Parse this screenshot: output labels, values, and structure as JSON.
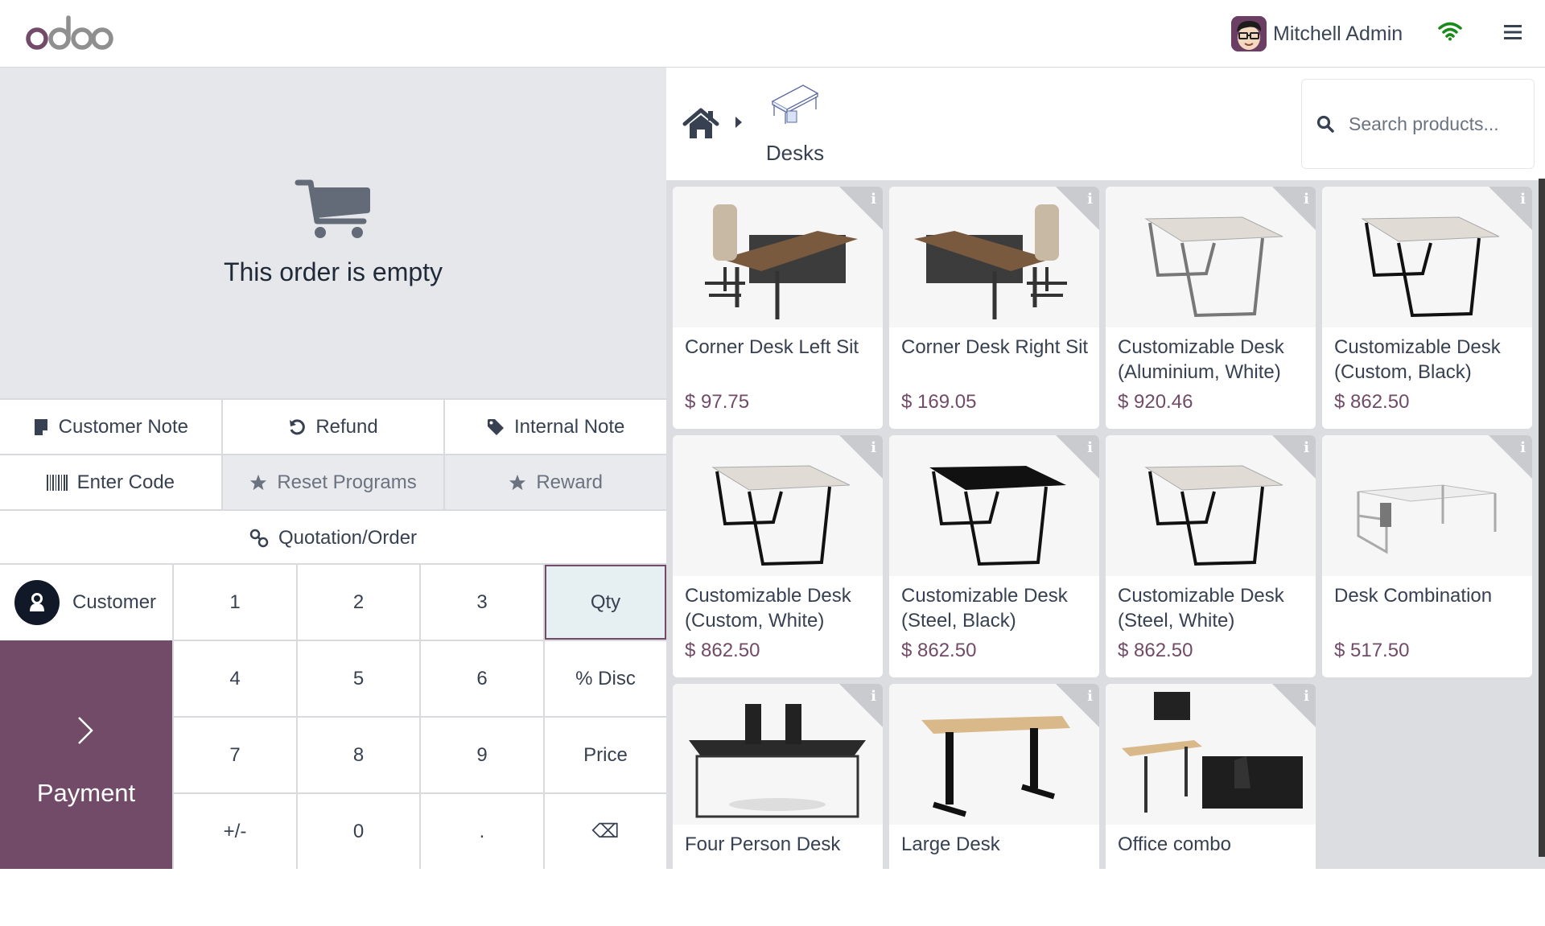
{
  "header": {
    "logo_text": "odoo",
    "user_name": "Mitchell Admin",
    "colors": {
      "brand": "#714b67",
      "logo_grey": "#8f8f8f",
      "wifi": "#1a8a1a"
    }
  },
  "cart": {
    "empty_message": "This order is empty",
    "icon": "shopping-cart-icon"
  },
  "controls": {
    "row1": [
      {
        "label": "Customer Note",
        "icon": "sticky-note-icon"
      },
      {
        "label": "Refund",
        "icon": "undo-icon"
      },
      {
        "label": "Internal Note",
        "icon": "tag-icon"
      }
    ],
    "row2": [
      {
        "label": "Enter Code",
        "icon": "barcode-icon"
      },
      {
        "label": "Reset Programs",
        "icon": "star-icon"
      },
      {
        "label": "Reward",
        "icon": "star-icon"
      }
    ],
    "row3": [
      {
        "label": "Quotation/Order",
        "icon": "link-icon"
      }
    ]
  },
  "numpad": {
    "customer_label": "Customer",
    "payment_label": "Payment",
    "keys": [
      [
        "1",
        "2",
        "3",
        "Qty"
      ],
      [
        "4",
        "5",
        "6",
        "% Disc"
      ],
      [
        "7",
        "8",
        "9",
        "Price"
      ],
      [
        "+/-",
        "0",
        ".",
        "⌫"
      ]
    ],
    "active_mode": "Qty"
  },
  "breadcrumb": {
    "home_icon": "home-icon",
    "category": "Desks"
  },
  "search": {
    "placeholder": "Search products...",
    "value": ""
  },
  "products": [
    {
      "name": "Corner Desk Left Sit",
      "price": "$ 97.75",
      "image": "corner-desk-left"
    },
    {
      "name": "Corner Desk Right Sit",
      "price": "$ 169.05",
      "image": "corner-desk-right"
    },
    {
      "name": "Customizable Desk (Aluminium, White)",
      "price": "$ 920.46",
      "image": "desk-aluminium-white"
    },
    {
      "name": "Customizable Desk (Custom, Black)",
      "price": "$ 862.50",
      "image": "desk-custom-black"
    },
    {
      "name": "Customizable Desk (Custom, White)",
      "price": "$ 862.50",
      "image": "desk-custom-white"
    },
    {
      "name": "Customizable Desk (Steel, Black)",
      "price": "$ 862.50",
      "image": "desk-steel-black"
    },
    {
      "name": "Customizable Desk (Steel, White)",
      "price": "$ 862.50",
      "image": "desk-steel-white"
    },
    {
      "name": "Desk Combination",
      "price": "$ 517.50",
      "image": "desk-combination"
    },
    {
      "name": "Four Person Desk",
      "price": "",
      "image": "four-person-desk"
    },
    {
      "name": "Large Desk",
      "price": "",
      "image": "large-desk"
    },
    {
      "name": "Office combo",
      "price": "",
      "image": "office-combo"
    }
  ]
}
